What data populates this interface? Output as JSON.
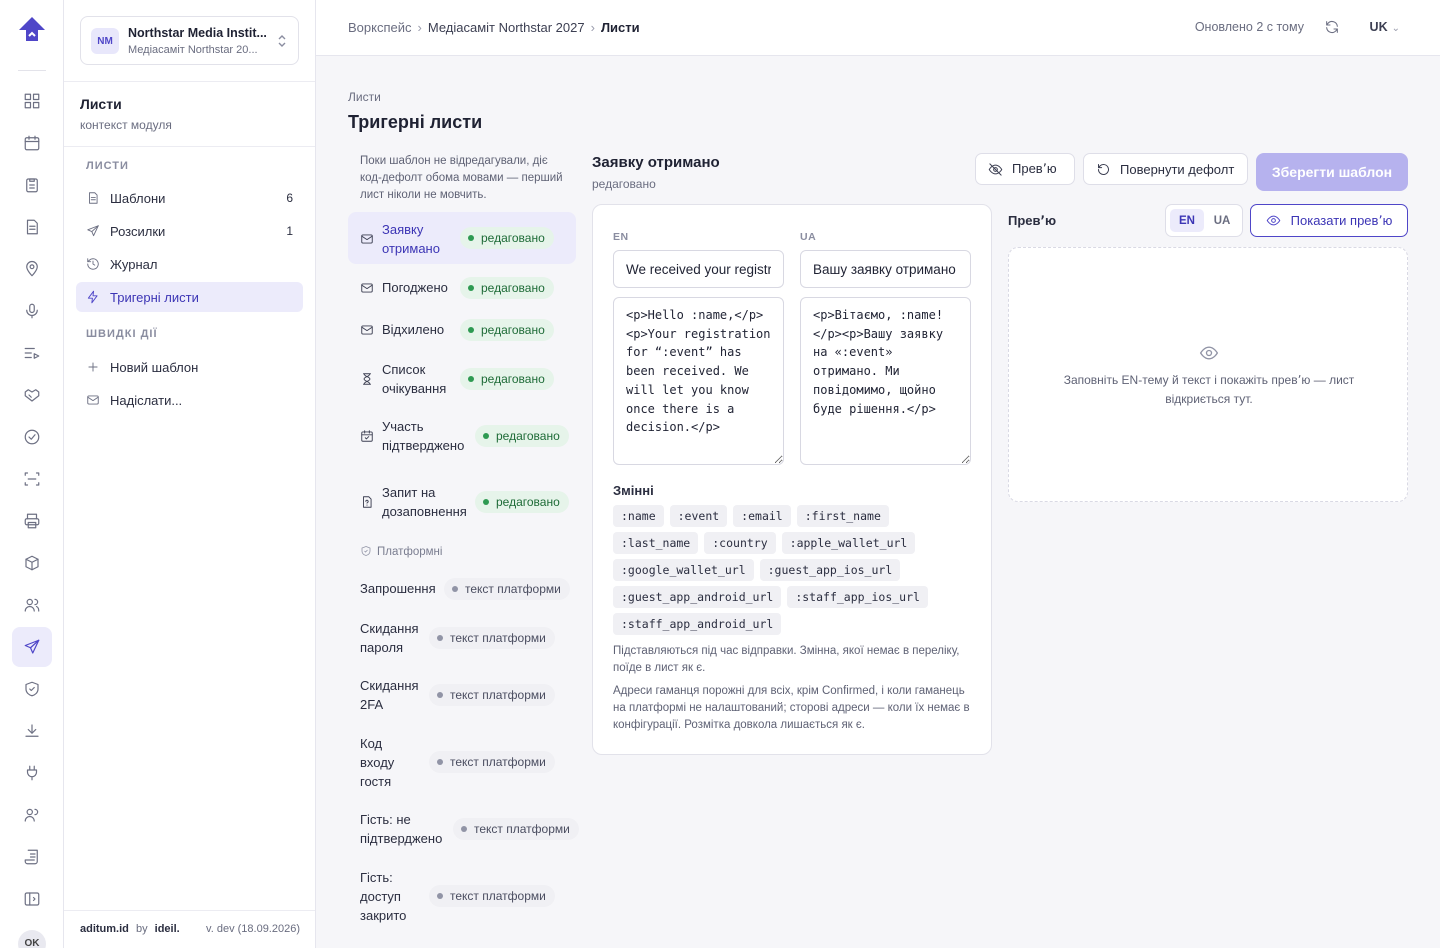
{
  "org": {
    "badge": "NM",
    "name": "Northstar Media Instit...",
    "sub": "Медіасаміт Northstar 20..."
  },
  "context": {
    "title": "Листи",
    "subtitle": "контекст модуля"
  },
  "sidebar": {
    "group_mail": "ЛИСТИ",
    "items": [
      {
        "label": "Шаблони",
        "count": "6",
        "icon": "file-icon"
      },
      {
        "label": "Розсилки",
        "count": "1",
        "icon": "send-icon"
      },
      {
        "label": "Журнал",
        "count": "",
        "icon": "history-icon"
      },
      {
        "label": "Тригерні листи",
        "count": "",
        "icon": "bolt-icon"
      }
    ],
    "group_quick": "ШВИДКІ ДІЇ",
    "quick": [
      {
        "label": "Новий шаблон",
        "icon": "plus-icon"
      },
      {
        "label": "Надіслати...",
        "icon": "mail-icon"
      }
    ]
  },
  "footer": {
    "brand": "aditum.id",
    "by": "by",
    "maker": "ideil.",
    "version": "v. dev (18.09.2026)"
  },
  "breadcrumb": {
    "root": "Воркспейс",
    "middle": "Медіасаміт Northstar 2027",
    "current": "Листи"
  },
  "status": {
    "updated": "Оновлено 2 с тому",
    "lang": "UK"
  },
  "page": {
    "eyebrow": "Листи",
    "title": "Тригерні листи"
  },
  "hint": "Поки шаблон не відредагували, діє код-дефолт обома мовами — перший лист ніколи не мовчить.",
  "triggers": [
    {
      "label": "Заявку отримано",
      "status": "редаговано",
      "icon": "mail-icon"
    },
    {
      "label": "Погоджено",
      "status": "редаговано",
      "icon": "mail-icon"
    },
    {
      "label": "Відхилено",
      "status": "редаговано",
      "icon": "mail-icon"
    },
    {
      "label": "Список очікування",
      "status": "редаговано",
      "icon": "hourglass-icon"
    },
    {
      "label": "Участь підтверджено",
      "status": "редаговано",
      "icon": "calendar-check-icon"
    },
    {
      "label": "Запит на дозаповнення",
      "status": "редаговано",
      "icon": "file-question-icon"
    }
  ],
  "platform_header": "Платформні",
  "platform": [
    {
      "label": "Запрошення",
      "status": "текст платформи"
    },
    {
      "label": "Скидання пароля",
      "status": "текст платформи"
    },
    {
      "label": "Скидання 2FA",
      "status": "текст платформи"
    },
    {
      "label": "Код входу гостя",
      "status": "текст платформи"
    },
    {
      "label": "Гість: не підтверджено",
      "status": "текст платформи"
    },
    {
      "label": "Гість: доступ закрито",
      "status": "текст платформи"
    }
  ],
  "editor": {
    "title": "Заявку отримано",
    "subtitle": "редаговано",
    "preview_btn": "Прев՚ю",
    "reset_btn": "Повернути дефолт",
    "save_btn": "Зберегти шаблон",
    "en_label": "EN",
    "ua_label": "UA",
    "en_subject": "We received your registration",
    "ua_subject": "Вашу заявку отримано",
    "en_body": "<p>Hello :name,</p><p>Your registration for “:event” has been received. We will let you know once there is a decision.</p>",
    "ua_body": "<p>Вітаємо, :name!</p><p>Вашу заявку на «:event» отримано. Ми повідомимо, щойно буде рішення.</p>",
    "vars_title": "Змінні",
    "variables": [
      ":name",
      ":event",
      ":email",
      ":first_name",
      ":last_name",
      ":country",
      ":apple_wallet_url",
      ":google_wallet_url",
      ":guest_app_ios_url",
      ":guest_app_android_url",
      ":staff_app_ios_url",
      ":staff_app_android_url"
    ],
    "note1": "Підставляються під час відправки. Змінна, якої немає в переліку, поїде в лист як є.",
    "note2": "Адреси гаманця порожні для всіх, крім Confirmed, і коли гаманець на платформі не налаштований; сторові адреси — коли їх немає в конфігурації. Розмітка довкола лишається як є."
  },
  "preview": {
    "label": "Прев՚ю",
    "seg_en": "EN",
    "seg_ua": "UA",
    "show_btn": "Показати прев՚ю",
    "empty_msg": "Заповніть EN-тему й текст і покажіть прев՚ю — лист відкриється тут."
  },
  "colors": {
    "accent": "#4f46c8",
    "accent_soft": "#ecebfb",
    "save_disabled": "#b6b2ee",
    "edited_green": "#2e9a52"
  }
}
